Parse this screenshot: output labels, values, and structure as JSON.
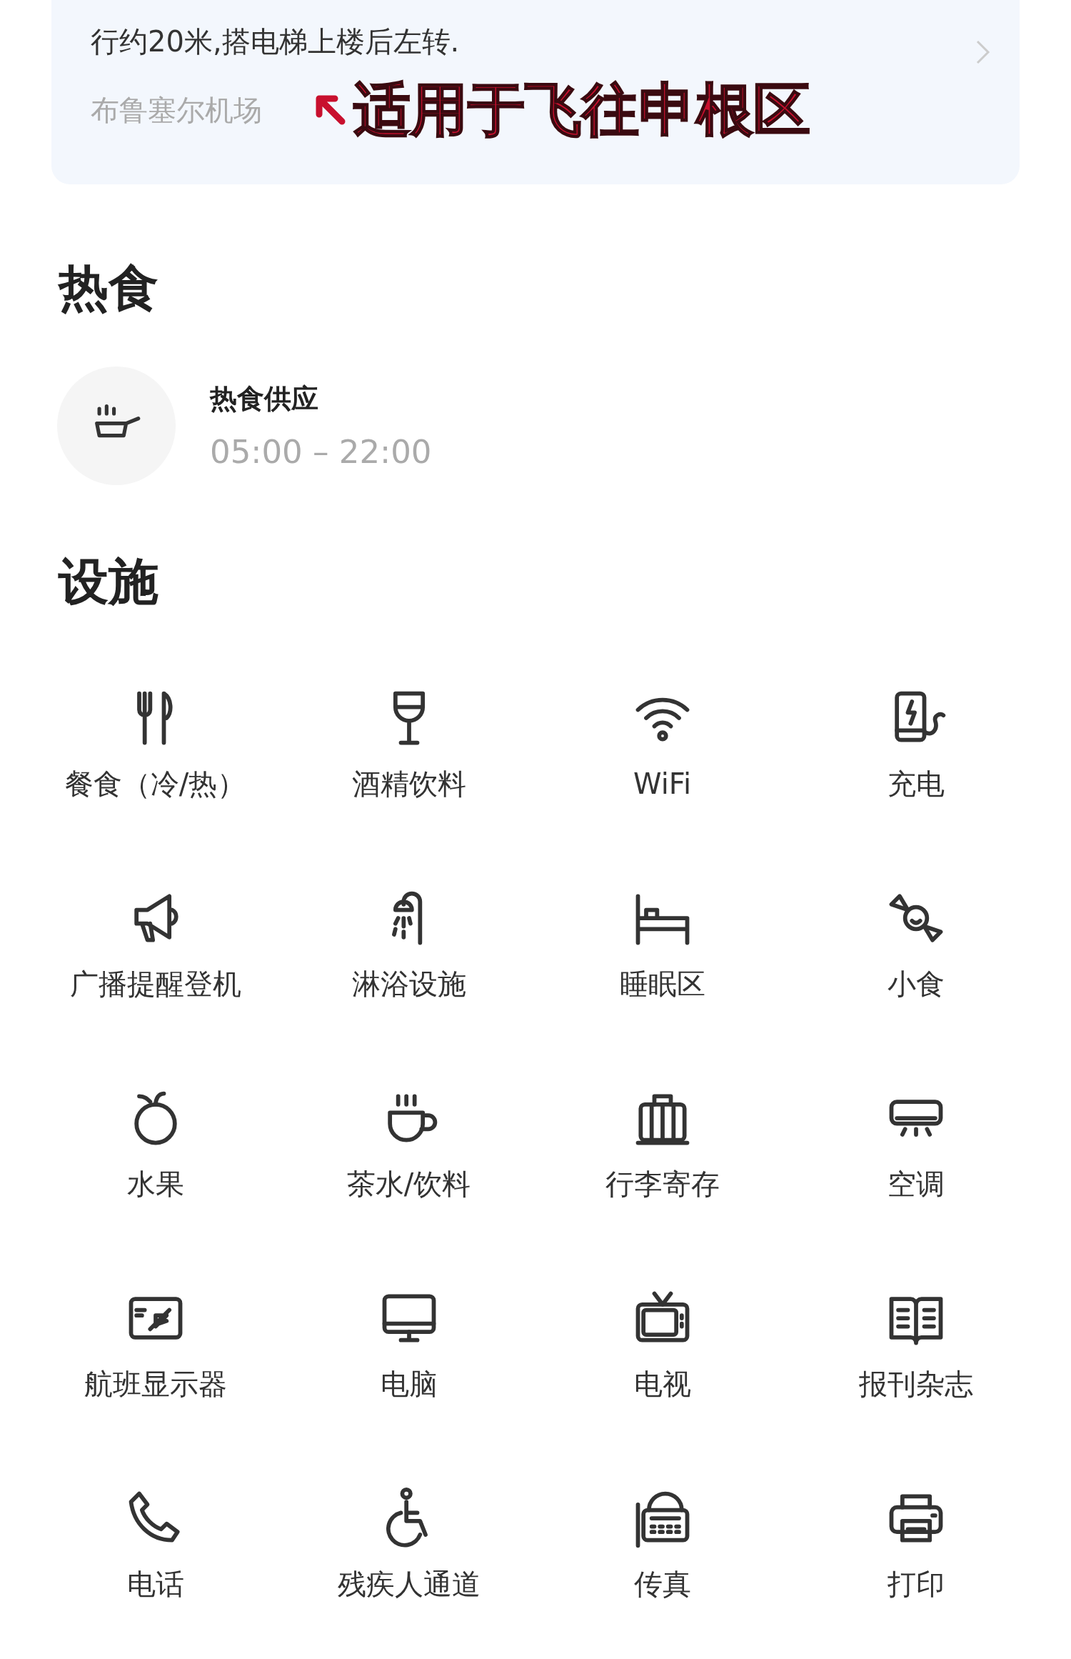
{
  "route_card": {
    "direction_text": "行约20米,搭电梯上楼后左转.",
    "airport": "布鲁塞尔机场",
    "annotation": "适用于飞往申根区"
  },
  "hot_food": {
    "heading": "热食",
    "title": "热食供应",
    "hours": "05:00 – 22:00"
  },
  "facilities": {
    "heading": "设施",
    "items": [
      {
        "label": "餐食（冷/热）"
      },
      {
        "label": "酒精饮料"
      },
      {
        "label": "WiFi"
      },
      {
        "label": "充电"
      },
      {
        "label": "广播提醒登机"
      },
      {
        "label": "淋浴设施"
      },
      {
        "label": "睡眠区"
      },
      {
        "label": "小食"
      },
      {
        "label": "水果"
      },
      {
        "label": "茶水/饮料"
      },
      {
        "label": "行李寄存"
      },
      {
        "label": "空调"
      },
      {
        "label": "航班显示器"
      },
      {
        "label": "电脑"
      },
      {
        "label": "电视"
      },
      {
        "label": "报刊杂志"
      },
      {
        "label": "电话"
      },
      {
        "label": "残疾人通道"
      },
      {
        "label": "传真"
      },
      {
        "label": "打印"
      }
    ]
  }
}
